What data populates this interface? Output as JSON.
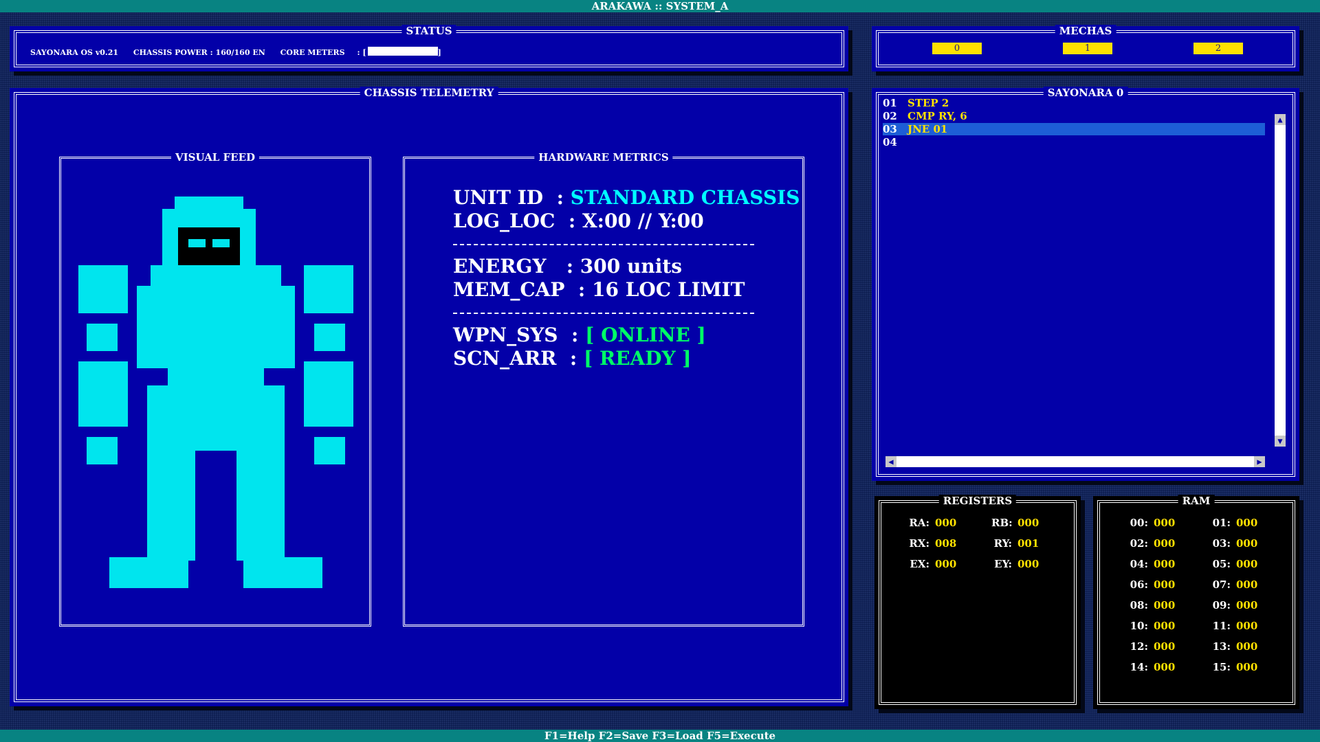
{
  "window": {
    "title": "ARAKAWA :: SYSTEM_A"
  },
  "status": {
    "title": "STATUS",
    "os": "SAYONARA OS v0.21",
    "power": "CHASSIS POWER : 160/160 EN",
    "core_label": "CORE METERS",
    "core_sep": ": [",
    "core_end": "]",
    "core_fill": 1.0
  },
  "mechas": {
    "title": "MECHAS",
    "tabs": [
      "0",
      "1",
      "2"
    ]
  },
  "telemetry": {
    "title": "CHASSIS TELEMETRY",
    "visual_title": "VISUAL FEED",
    "hw_title": "HARDWARE METRICS",
    "unit_id_label": "UNIT ID  : ",
    "unit_id_value": "STANDARD CHASSIS",
    "log_loc_label": "LOG_LOC  : ",
    "log_loc_value": "X:00 // Y:00",
    "energy_label": "ENERGY   : ",
    "energy_value": "300 units",
    "mem_label": "MEM_CAP  : ",
    "mem_value": "16 LOC LIMIT",
    "wpn_label": "WPN_SYS  : ",
    "wpn_value": "[ ONLINE ]",
    "scn_label": "SCN_ARR  : ",
    "scn_value": "[ READY ]"
  },
  "program": {
    "title": "SAYONARA 0",
    "lines": [
      {
        "num": "01",
        "code": "STEP 2"
      },
      {
        "num": "02",
        "code": "CMP RY, 6"
      },
      {
        "num": "03",
        "code": "JNE 01"
      },
      {
        "num": "04",
        "code": ""
      }
    ],
    "active_line": 3
  },
  "registers": {
    "title": "REGISTERS",
    "items": [
      {
        "name": "RA:",
        "value": "000"
      },
      {
        "name": "RB:",
        "value": "000"
      },
      {
        "name": "RX:",
        "value": "008"
      },
      {
        "name": "RY:",
        "value": "001"
      },
      {
        "name": "EX:",
        "value": "000"
      },
      {
        "name": "EY:",
        "value": "000"
      }
    ]
  },
  "ram": {
    "title": "RAM",
    "items": [
      {
        "addr": "00:",
        "value": "000"
      },
      {
        "addr": "01:",
        "value": "000"
      },
      {
        "addr": "02:",
        "value": "000"
      },
      {
        "addr": "03:",
        "value": "000"
      },
      {
        "addr": "04:",
        "value": "000"
      },
      {
        "addr": "05:",
        "value": "000"
      },
      {
        "addr": "06:",
        "value": "000"
      },
      {
        "addr": "07:",
        "value": "000"
      },
      {
        "addr": "08:",
        "value": "000"
      },
      {
        "addr": "09:",
        "value": "000"
      },
      {
        "addr": "10:",
        "value": "000"
      },
      {
        "addr": "11:",
        "value": "000"
      },
      {
        "addr": "12:",
        "value": "000"
      },
      {
        "addr": "13:",
        "value": "000"
      },
      {
        "addr": "14:",
        "value": "000"
      },
      {
        "addr": "15:",
        "value": "000"
      }
    ]
  },
  "footer": {
    "keys": "F1=Help F2=Save F3=Load F5=Execute"
  },
  "colors": {
    "panel_blue": "#0300a8",
    "accent_yellow": "#ffe100",
    "cyan": "#00ffff",
    "green": "#00ff66",
    "teal_bar": "#088382",
    "highlight": "#1d5ed6"
  },
  "icons": [
    "scroll-up-arrow-icon",
    "scroll-down-arrow-icon",
    "scroll-left-arrow-icon",
    "scroll-right-arrow-icon",
    "mecha-robot-icon"
  ]
}
